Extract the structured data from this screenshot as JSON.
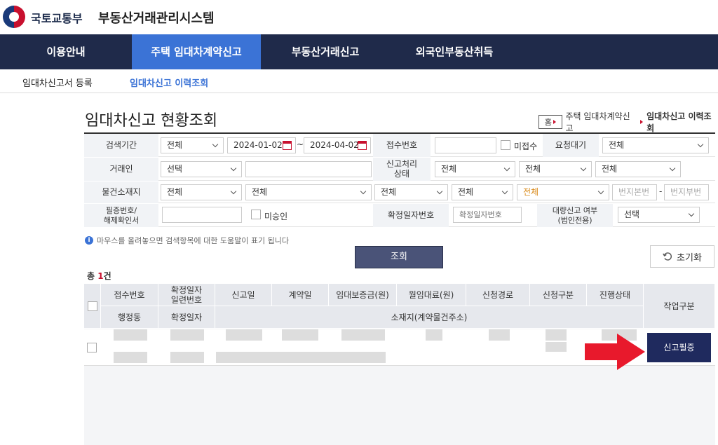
{
  "header": {
    "ministry": "국토교통부",
    "system": "부동산거래관리시스템"
  },
  "nav": {
    "items": [
      "이용안내",
      "주택 임대차계약신고",
      "부동산거래신고",
      "외국인부동산취득"
    ]
  },
  "subnav": {
    "items": [
      "임대차신고서 등록",
      "임대차신고 이력조회"
    ]
  },
  "page": {
    "title": "임대차신고 현황조회"
  },
  "breadcrumb": {
    "home": "홈",
    "level1": "주택 임대차계약신고",
    "current": "임대차신고 이력조회"
  },
  "form": {
    "period": {
      "label": "검색기간",
      "type": "전체",
      "from": "2024-01-02",
      "sep": "~",
      "to": "2024-04-02"
    },
    "receipt": {
      "label": "접수번호",
      "value": "",
      "unreceived": "미접수"
    },
    "request_wait": {
      "label": "요청대기",
      "value": "전체"
    },
    "party": {
      "label": "거래인",
      "select": "선택",
      "value": ""
    },
    "process": {
      "label": "신고처리\n상태",
      "s1": "전체",
      "s2": "전체",
      "s3": "전체"
    },
    "location": {
      "label": "물건소재지",
      "s1": "전체",
      "s2": "전체",
      "s3": "전체",
      "s4": "전체",
      "s5": "전체",
      "main_no": "번지본번",
      "dash": "-",
      "sub_no": "번지부번"
    },
    "cert": {
      "label": "필증번호/\n해제확인서",
      "value": "",
      "unapproved": "미승인"
    },
    "fixed_date": {
      "label": "확정일자번호",
      "placeholder": "확정일자번호"
    },
    "bulk": {
      "label": "대량신고 여부\n(법인전용)",
      "value": "선택"
    }
  },
  "help": {
    "icon": "i",
    "text": "마우스를 올려놓으면 검색항목에 대한 도움말이 표기 됩니다"
  },
  "buttons": {
    "search": "조회",
    "reset": "초기화",
    "cert": "신고필증"
  },
  "total": {
    "prefix": "총 ",
    "count": "1",
    "suffix": "건"
  },
  "table": {
    "top_headers": [
      "접수번호",
      "확정일자\n일련번호",
      "신고일",
      "계약일",
      "임대보증금(원)",
      "월임대료(원)",
      "신청경로",
      "신청구분",
      "진행상태"
    ],
    "bottom_headers": [
      "행정동",
      "확정일자",
      "소재지(계약물건주소)"
    ],
    "work_header": "작업구분"
  },
  "colors": {
    "nav_bg": "#1f2a4a",
    "nav_active": "#3b73d6",
    "arrow": "#e8192c",
    "cert_button": "#1f2a5e"
  }
}
